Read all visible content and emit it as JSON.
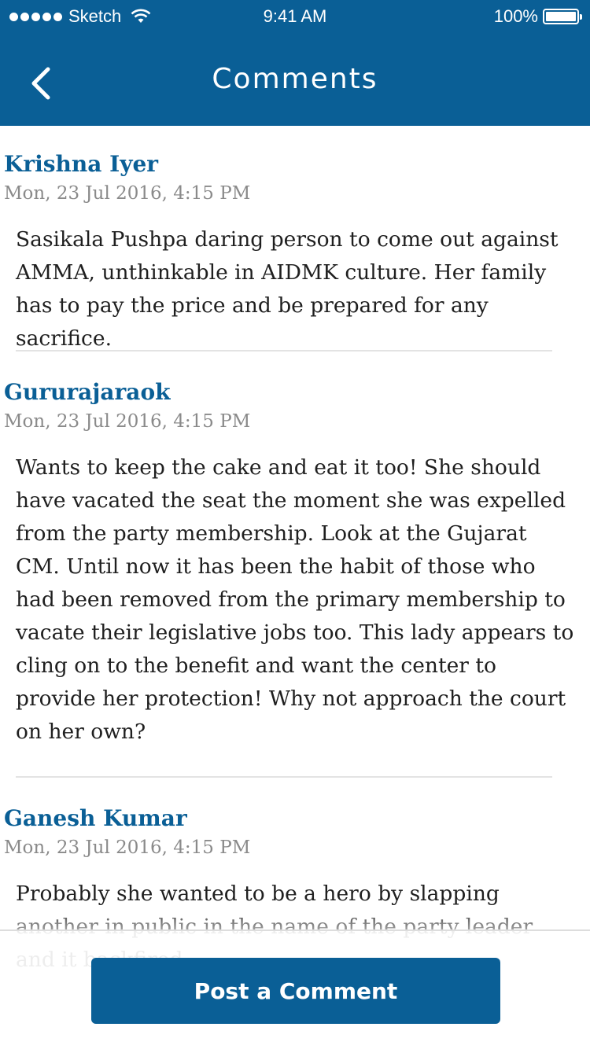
{
  "status_bar": {
    "carrier": "Sketch",
    "time": "9:41 AM",
    "battery": "100%"
  },
  "header": {
    "title": "Comments"
  },
  "comments": [
    {
      "author": "Krishna Iyer",
      "date": "Mon, 23 Jul 2016, 4:15 PM",
      "text": "Sasikala Pushpa daring person to come out against\nAMMA, unthinkable in AIDMK culture. Her family\nhas to pay the price and be prepared for any sacrifice."
    },
    {
      "author": "Gururajaraok",
      "date": "Mon, 23 Jul 2016, 4:15 PM",
      "text": "Wants to keep the cake and eat it too! She should\nhave vacated the seat the moment she was expelled\nfrom the party membership. Look at the Gujarat\nCM. Until now it has been the habit of those who\nhad been removed from the primary membership to\nvacate their legislative jobs too. This lady appears to\ncling on to the benefit and want the center to\nprovide her protection! Why not approach the court\non her own?"
    },
    {
      "author": "Ganesh Kumar",
      "date": "Mon, 23 Jul 2016, 4:15 PM",
      "text": "Probably she wanted to be a hero by slapping\nanother in public in the name of the party leader\nand it backfired."
    }
  ],
  "footer": {
    "post_button_label": "Post a Comment"
  },
  "colors": {
    "brand": "#0a5f96",
    "text": "#1f1f1f",
    "muted": "#8a8a8a"
  }
}
